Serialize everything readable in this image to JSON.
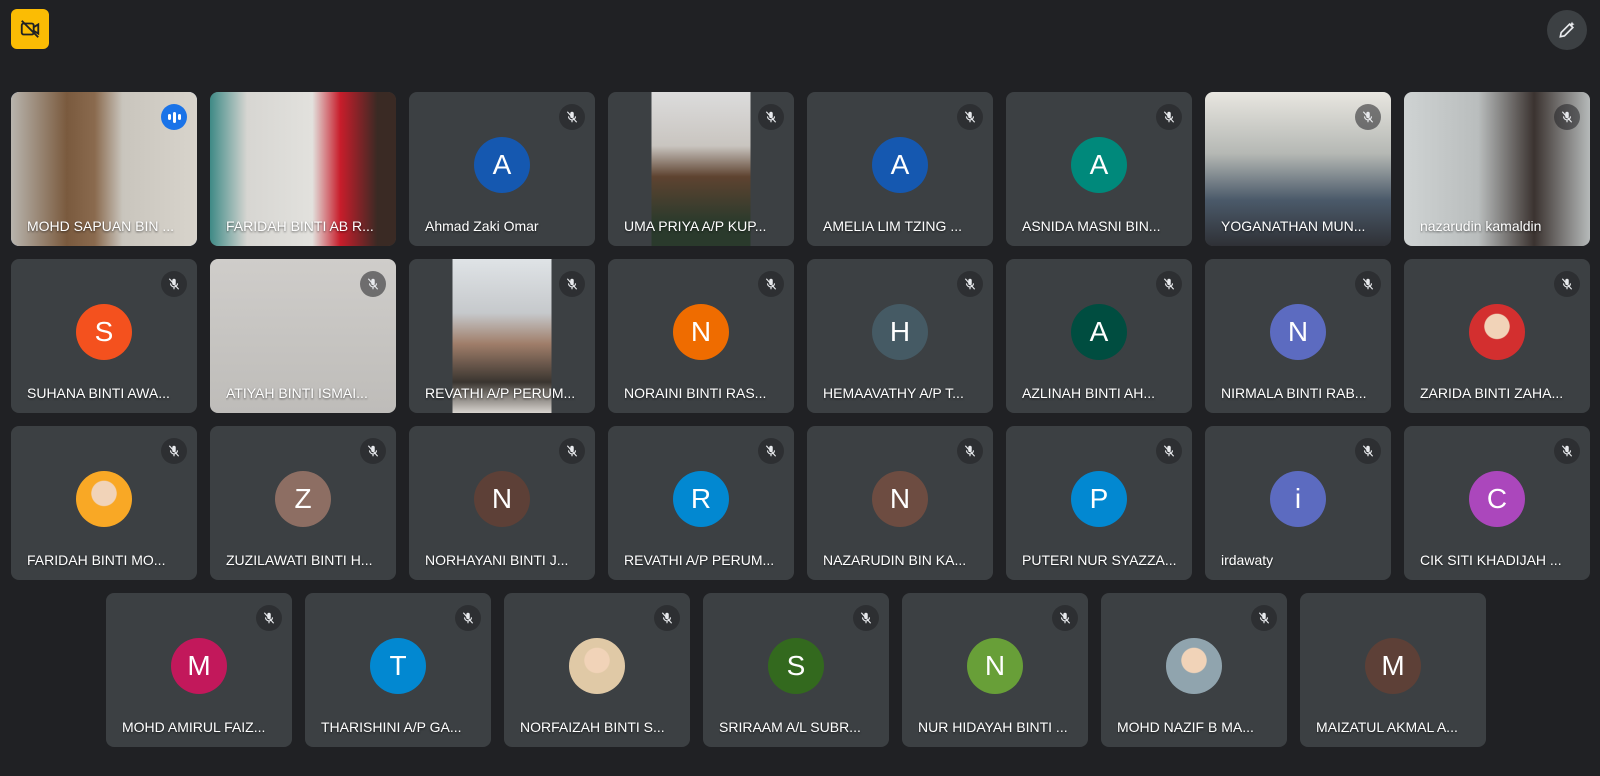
{
  "toolbar": {
    "left_icon": "camera-off-icon",
    "left_color": "#fbbc04",
    "right_icon": "edit-pen-icon"
  },
  "participants": [
    {
      "name": "MOHD SAPUAN BIN ...",
      "avatar_type": "video",
      "status": "speaking",
      "video_palette": "office-two-people"
    },
    {
      "name": "FARIDAH BINTI AB R...",
      "avatar_type": "video",
      "status": "muted-none",
      "video_palette": "woman-red-hijab"
    },
    {
      "name": "Ahmad Zaki Omar",
      "avatar_type": "letter",
      "letter": "A",
      "color": "#1558b0",
      "status": "muted"
    },
    {
      "name": "UMA PRIYA A/P KUP...",
      "avatar_type": "video-narrow",
      "status": "muted",
      "video_palette": "woman-portrait"
    },
    {
      "name": "AMELIA LIM TZING ...",
      "avatar_type": "letter",
      "letter": "A",
      "color": "#1558b0",
      "status": "muted"
    },
    {
      "name": "ASNIDA MASNI BIN...",
      "avatar_type": "letter",
      "letter": "A",
      "color": "#00897b",
      "status": "muted"
    },
    {
      "name": "YOGANATHAN MUN...",
      "avatar_type": "video",
      "status": "muted",
      "video_palette": "office-men"
    },
    {
      "name": "nazarudin kamaldin",
      "avatar_type": "video",
      "status": "muted",
      "video_palette": "man-portrait"
    },
    {
      "name": "SUHANA BINTI AWA...",
      "avatar_type": "letter",
      "letter": "S",
      "color": "#f4511e",
      "status": "muted"
    },
    {
      "name": "ATIYAH BINTI ISMAI...",
      "avatar_type": "video",
      "status": "muted",
      "video_palette": "blank-wall"
    },
    {
      "name": "REVATHI A/P PERUM...",
      "avatar_type": "video-narrow",
      "status": "muted",
      "video_palette": "woman-office"
    },
    {
      "name": "NORAINI BINTI RAS...",
      "avatar_type": "letter",
      "letter": "N",
      "color": "#ef6c00",
      "status": "muted"
    },
    {
      "name": "HEMAAVATHY A/P T...",
      "avatar_type": "letter",
      "letter": "H",
      "color": "#455a64",
      "status": "muted"
    },
    {
      "name": "AZLINAH BINTI AH...",
      "avatar_type": "letter",
      "letter": "A",
      "color": "#004d40",
      "status": "muted"
    },
    {
      "name": "NIRMALA BINTI RAB...",
      "avatar_type": "letter",
      "letter": "N",
      "color": "#5c6bc0",
      "status": "muted"
    },
    {
      "name": "ZARIDA BINTI ZAHA...",
      "avatar_type": "photo",
      "color": "#d32f2f",
      "status": "muted"
    },
    {
      "name": "FARIDAH BINTI MO...",
      "avatar_type": "photo",
      "color": "#f9a825",
      "status": "muted"
    },
    {
      "name": "ZUZILAWATI BINTI H...",
      "avatar_type": "letter",
      "letter": "Z",
      "color": "#8d6e63",
      "status": "muted"
    },
    {
      "name": "NORHAYANI BINTI J...",
      "avatar_type": "letter",
      "letter": "N",
      "color": "#5d4037",
      "status": "muted"
    },
    {
      "name": "REVATHI A/P PERUM...",
      "avatar_type": "letter",
      "letter": "R",
      "color": "#0288d1",
      "status": "muted"
    },
    {
      "name": "NAZARUDIN BIN KA...",
      "avatar_type": "letter",
      "letter": "N",
      "color": "#6d4c41",
      "status": "muted"
    },
    {
      "name": "PUTERI NUR SYAZZA...",
      "avatar_type": "letter",
      "letter": "P",
      "color": "#0288d1",
      "status": "muted"
    },
    {
      "name": "irdawaty",
      "avatar_type": "letter",
      "letter": "i",
      "color": "#5c6bc0",
      "status": "muted"
    },
    {
      "name": "CIK SITI KHADIJAH ...",
      "avatar_type": "letter",
      "letter": "C",
      "color": "#ab47bc",
      "status": "muted"
    },
    {
      "name": "MOHD AMIRUL FAIZ...",
      "avatar_type": "letter",
      "letter": "M",
      "color": "#c2185b",
      "status": "muted"
    },
    {
      "name": "THARISHINI A/P GA...",
      "avatar_type": "letter",
      "letter": "T",
      "color": "#0288d1",
      "status": "muted"
    },
    {
      "name": "NORFAIZAH BINTI S...",
      "avatar_type": "photo",
      "color": "#e0c9a6",
      "status": "muted"
    },
    {
      "name": "SRIRAAM A/L SUBR...",
      "avatar_type": "letter",
      "letter": "S",
      "color": "#33691e",
      "status": "muted"
    },
    {
      "name": "NUR HIDAYAH BINTI ...",
      "avatar_type": "letter",
      "letter": "N",
      "color": "#689f38",
      "status": "muted"
    },
    {
      "name": "MOHD NAZIF B MA...",
      "avatar_type": "photo",
      "color": "#90a4ae",
      "status": "muted"
    },
    {
      "name": "MAIZATUL AKMAL A...",
      "avatar_type": "letter",
      "letter": "M",
      "color": "#5d4037",
      "status": "none"
    }
  ]
}
